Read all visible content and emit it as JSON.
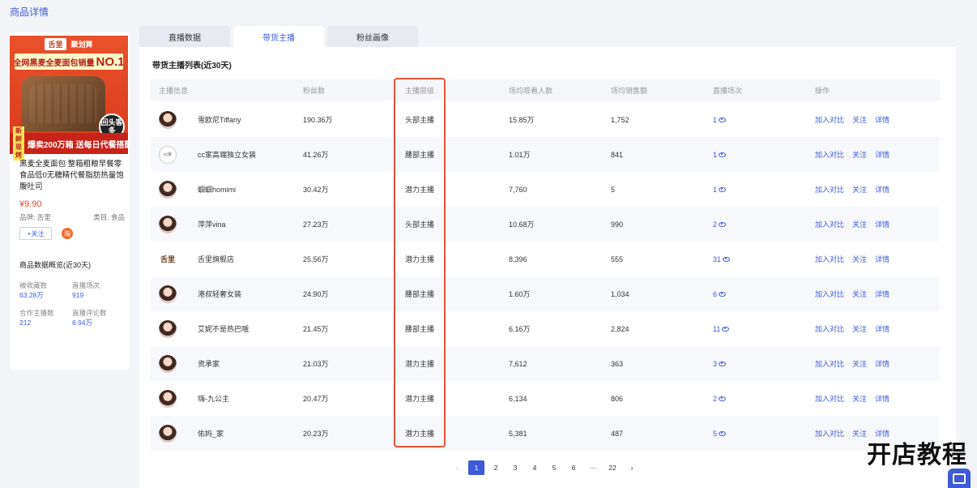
{
  "page": {
    "header": "商品详情"
  },
  "product": {
    "image": {
      "logo": "舌里",
      "logo_tag": "聚划算",
      "banner_prefix": "全网黑麦全麦面包销量",
      "banner_rank": "NO.1",
      "badge": "回头客多",
      "bottom_left": "新鲜现烤",
      "bottom_right": "爆卖200万箱  送每日代餐搭配"
    },
    "title": "黑麦全麦面包 整箱粗粮早餐零食品低0无糖精代餐脂肪热量饱腹吐司",
    "price": "¥9.90",
    "brand_label": "品牌: 舌里",
    "category_label": "类目: 食品",
    "follow_label": "+关注",
    "shop_icon_text": "淘",
    "overview_title": "商品数据概览(近30天)",
    "stats": [
      {
        "label": "被收藏数",
        "value": "63.28万"
      },
      {
        "label": "直播场次",
        "value": "919"
      },
      {
        "label": "合作主播数",
        "value": "212"
      },
      {
        "label": "直播评论数",
        "value": "6.94万"
      }
    ]
  },
  "tabs": [
    {
      "label": "直播数据",
      "active": false
    },
    {
      "label": "带货主播",
      "active": true
    },
    {
      "label": "粉丝画像",
      "active": false
    }
  ],
  "list": {
    "title": "带货主播列表(近30天)",
    "columns": {
      "anchor": "主播信息",
      "fans": "粉丝数",
      "level": "主播层级",
      "viewers": "场均观看人数",
      "sales": "场均销售额",
      "sessions": "直播场次",
      "ops": "操作"
    },
    "ops_labels": {
      "compare": "加入对比",
      "follow": "关注",
      "detail": "详情"
    },
    "rows": [
      {
        "name": "雪欧尼Tiffany",
        "fans": "190.36万",
        "level": "头部主播",
        "viewers": "15.85万",
        "sales": "1,752",
        "sessions": "1"
      },
      {
        "name": "cc家高端独立女装",
        "fans": "41.26万",
        "level": "腰部主播",
        "viewers": "1.01万",
        "sales": "841",
        "sessions": "1"
      },
      {
        "name": "蝈蝈homimi",
        "fans": "30.42万",
        "level": "潜力主播",
        "viewers": "7,760",
        "sales": "5",
        "sessions": "1"
      },
      {
        "name": "萍萍vina",
        "fans": "27.23万",
        "level": "头部主播",
        "viewers": "10.68万",
        "sales": "990",
        "sessions": "2"
      },
      {
        "name": "舌里旗舰店",
        "fans": "25.56万",
        "level": "潜力主播",
        "viewers": "8,396",
        "sales": "555",
        "sessions": "31"
      },
      {
        "name": "港叔轻奢女装",
        "fans": "24.90万",
        "level": "腰部主播",
        "viewers": "1.60万",
        "sales": "1,034",
        "sessions": "6"
      },
      {
        "name": "艾妮不是热巴哦",
        "fans": "21.45万",
        "level": "腰部主播",
        "viewers": "6.16万",
        "sales": "2,824",
        "sessions": "11"
      },
      {
        "name": "资承家",
        "fans": "21.03万",
        "level": "潜力主播",
        "viewers": "7,612",
        "sales": "363",
        "sessions": "3"
      },
      {
        "name": "嗨-九公主",
        "fans": "20.47万",
        "level": "潜力主播",
        "viewers": "6,134",
        "sales": "806",
        "sessions": "2"
      },
      {
        "name": "佑妈_家",
        "fans": "20.23万",
        "level": "潜力主播",
        "viewers": "5,381",
        "sales": "487",
        "sessions": "5"
      }
    ],
    "avatar_texts": {
      "cc": "cc家",
      "shop": "舌里"
    }
  },
  "pagination": {
    "prev": "‹",
    "pages": [
      "1",
      "2",
      "3",
      "4",
      "5",
      "6",
      "···",
      "22"
    ],
    "active": "1",
    "next": "›"
  },
  "watermark": "开店教程"
}
